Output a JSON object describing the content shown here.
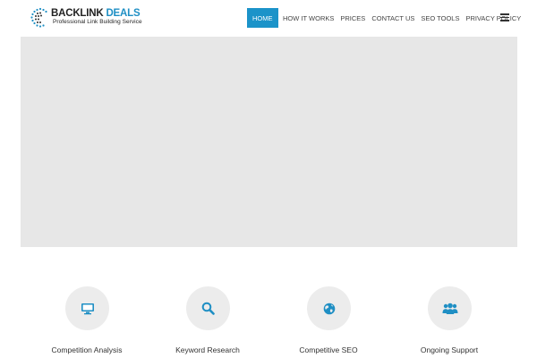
{
  "brand": {
    "name_part1": "BACKLINK",
    "name_part2": "DEALS",
    "tagline": "Professional Link Building Service",
    "primary_color": "#1f8fc4",
    "dark_color": "#222222"
  },
  "nav": {
    "items": [
      {
        "label": "HOME",
        "active": true
      },
      {
        "label": "HOW IT WORKS",
        "active": false
      },
      {
        "label": "PRICES",
        "active": false
      },
      {
        "label": "CONTACT US",
        "active": false
      },
      {
        "label": "SEO TOOLS",
        "active": false
      },
      {
        "label": "PRIVACY POLICY",
        "active": false
      }
    ],
    "menu_icon": "hamburger-icon",
    "active_color": "#1b93c9"
  },
  "hero": {
    "background": "#e7e7e7"
  },
  "features": [
    {
      "label": "Competition Analysis",
      "icon": "monitor-icon"
    },
    {
      "label": "Keyword Research",
      "icon": "search-icon"
    },
    {
      "label": "Competitive SEO",
      "icon": "globe-icon"
    },
    {
      "label": "Ongoing Support",
      "icon": "users-icon"
    }
  ],
  "icon_color": "#1f8fc4"
}
